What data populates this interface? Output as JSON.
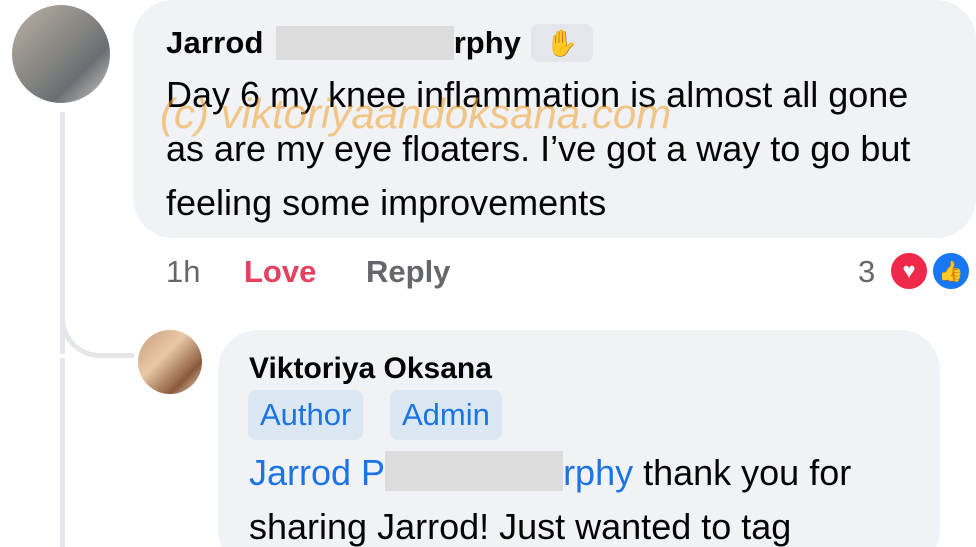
{
  "comment": {
    "author_first": "Jarrod",
    "author_last_tail": "rphy",
    "badge_icon": "wave-icon",
    "text": "Day 6 my knee inflammation is almost all gone as are my eye floaters.  I’ve got a way to go but feeling some improvements",
    "time": "1h",
    "love_label": "Love",
    "reply_label": "Reply",
    "reaction_count": "3"
  },
  "watermark": "(c) viktoriyaandoksana.com",
  "reply": {
    "author": "Viktoriya Oksana",
    "badges": [
      "Author",
      "Admin"
    ],
    "mention_start": "Jarrod P",
    "mention_end": "rphy",
    "text": " thank you for sharing Jarrod! Just wanted to tag"
  },
  "colors": {
    "bubble": "#f0f2f5",
    "love": "#e4405f",
    "link": "#1b74e4",
    "heart": "#f02849",
    "like": "#1877f2"
  }
}
